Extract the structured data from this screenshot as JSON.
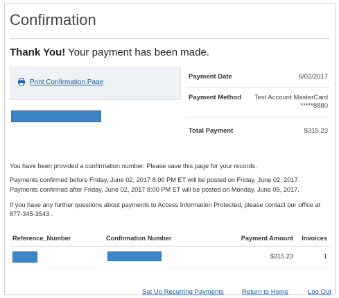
{
  "header": {
    "title": "Confirmation"
  },
  "message": {
    "thank_you": "Thank You!",
    "made": " Your payment has been made."
  },
  "print": {
    "label": "Print Confirmation Page",
    "icon": "printer-icon"
  },
  "payment": {
    "date_label": "Payment Date",
    "date_value": "6/02/2017",
    "method_label": "Payment Method",
    "method_value_line1": "Test Account MasterCard",
    "method_value_line2": "*****8880",
    "total_label": "Total Payment",
    "total_value": "$315.23"
  },
  "notes": {
    "records": "You have been provided a confirmation number. Please save this page for your records.",
    "before": "Payments confirmed before Friday, June 02, 2017 8:00 PM ET will be posted on Friday, June 02, 2017.",
    "after": "Payments confirmed after Friday, June 02, 2017 8:00 PM ET will be posted on Monday, June 05, 2017.",
    "contact": "If you have any further questions about payments to Access Information Protected, please contact our office at 877-345-3543 ."
  },
  "table": {
    "headers": [
      "Reference_Number",
      "Confirmation Number",
      "Payment Amount",
      "Invoices"
    ],
    "row": {
      "amount": "$315.23",
      "invoices": "1"
    }
  },
  "footer": {
    "recurring": "Set Up Recurring Payments",
    "home": "Return to Home",
    "logout": "Log Out"
  },
  "colors": {
    "link": "#1e5aa8",
    "redaction": "#3e84c8",
    "panel": "#eef2f6"
  }
}
